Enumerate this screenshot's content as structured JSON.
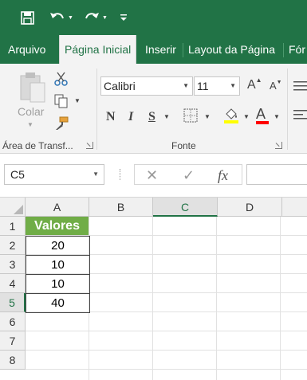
{
  "colors": {
    "excel_green": "#217346",
    "header_fill": "#70ad47"
  },
  "qat": {
    "icons": [
      "save-icon",
      "undo-icon",
      "redo-icon",
      "customize-icon"
    ]
  },
  "tabs": [
    "Arquivo",
    "Página Inicial",
    "Inserir",
    "Layout da Página",
    "Fór"
  ],
  "ribbon": {
    "clipboard": {
      "paste_label": "Colar",
      "group_label": "Área de Transf..."
    },
    "font": {
      "font_name": "Calibri",
      "font_size": "11",
      "bold": "N",
      "italic": "I",
      "underline": "S",
      "font_color_letter": "A",
      "grow_letter": "A",
      "shrink_letter": "A",
      "group_label": "Fonte"
    }
  },
  "formula_bar": {
    "name_box": "C5",
    "cancel": "✕",
    "enter": "✓",
    "fx": "fx"
  },
  "sheet": {
    "columns": [
      "A",
      "B",
      "C",
      "D"
    ],
    "rows": [
      "1",
      "2",
      "3",
      "4",
      "5",
      "6",
      "7",
      "8"
    ],
    "cells": {
      "A1": "Valores",
      "A2": "20",
      "A3": "10",
      "A4": "10",
      "A5": "40"
    },
    "active_cell": "C5"
  }
}
